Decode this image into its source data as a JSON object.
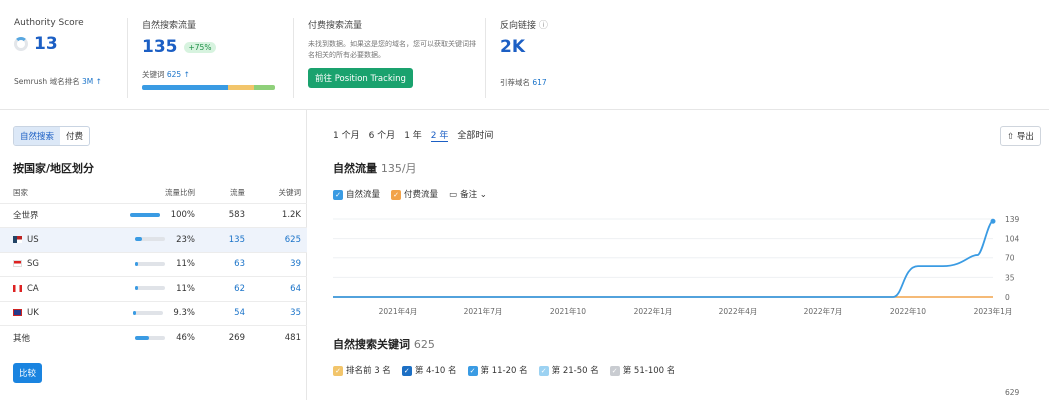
{
  "colors": {
    "accent": "#1c5fc4",
    "green": "#1aa26e",
    "line": "#3a9be3",
    "orange": "#f2a34a"
  },
  "top": {
    "authority": {
      "title": "Authority Score",
      "value": "13",
      "rank_label": "Semrush 域名排名",
      "rank_value": "3M ↑"
    },
    "organic": {
      "title": "自然搜索流量",
      "value": "135",
      "badge": "+75%",
      "kw_label": "关键词",
      "kw_value": "625 ↑"
    },
    "paid": {
      "title": "付费搜索流量",
      "desc": "未找到数据。如果这是您的域名，您可以获取关键词排名相关的所有必要数据。",
      "button": "前往 Position Tracking"
    },
    "backlinks": {
      "title": "反向链接",
      "value": "2K",
      "ref_label": "引荐域名",
      "ref_value": "617"
    }
  },
  "left": {
    "tabs": [
      "自然搜索",
      "付费"
    ],
    "title": "按国家/地区划分",
    "headers": [
      "国家",
      "流量比例",
      "流量",
      "关键词"
    ],
    "rows": [
      {
        "name": "全世界",
        "share": "100%",
        "traffic": "583",
        "keywords": "1.2K",
        "pct": 1.0
      },
      {
        "name": "US",
        "share": "23%",
        "traffic": "135",
        "keywords": "625",
        "pct": 0.23
      },
      {
        "name": "SG",
        "share": "11%",
        "traffic": "63",
        "keywords": "39",
        "pct": 0.11
      },
      {
        "name": "CA",
        "share": "11%",
        "traffic": "62",
        "keywords": "64",
        "pct": 0.11
      },
      {
        "name": "UK",
        "share": "9.3%",
        "traffic": "54",
        "keywords": "35",
        "pct": 0.093
      },
      {
        "name": "其他",
        "share": "46%",
        "traffic": "269",
        "keywords": "481",
        "pct": 0.46
      }
    ],
    "compare": "比较"
  },
  "range": [
    "1 个月",
    "6 个月",
    "1 年",
    "2 年",
    "全部时间"
  ],
  "export": "导出",
  "traffic_chart": {
    "title": "自然流量",
    "sub": "135/月",
    "legend": [
      "自然流量",
      "付费流量",
      "备注"
    ]
  },
  "keywords_chart": {
    "title": "自然搜索关键词",
    "sub": "625",
    "legend": [
      "排名前 3 名",
      "第 4-10 名",
      "第 11-20 名",
      "第 21-50 名",
      "第 51-100 名"
    ],
    "top_tick": "629"
  },
  "chart_data": {
    "type": "line",
    "x": [
      "2021年4月",
      "2021年7月",
      "2021年10",
      "2022年1月",
      "2022年4月",
      "2022年7月",
      "2022年10",
      "2023年1月"
    ],
    "series": [
      {
        "name": "自然流量",
        "values": [
          0,
          0,
          0,
          0,
          0,
          0,
          55,
          135
        ]
      },
      {
        "name": "付费流量",
        "values": [
          0,
          0,
          0,
          0,
          0,
          0,
          0,
          0
        ]
      }
    ],
    "yticks": [
      "139",
      "104",
      "70",
      "35",
      "0"
    ],
    "ylim": [
      0,
      139
    ]
  }
}
